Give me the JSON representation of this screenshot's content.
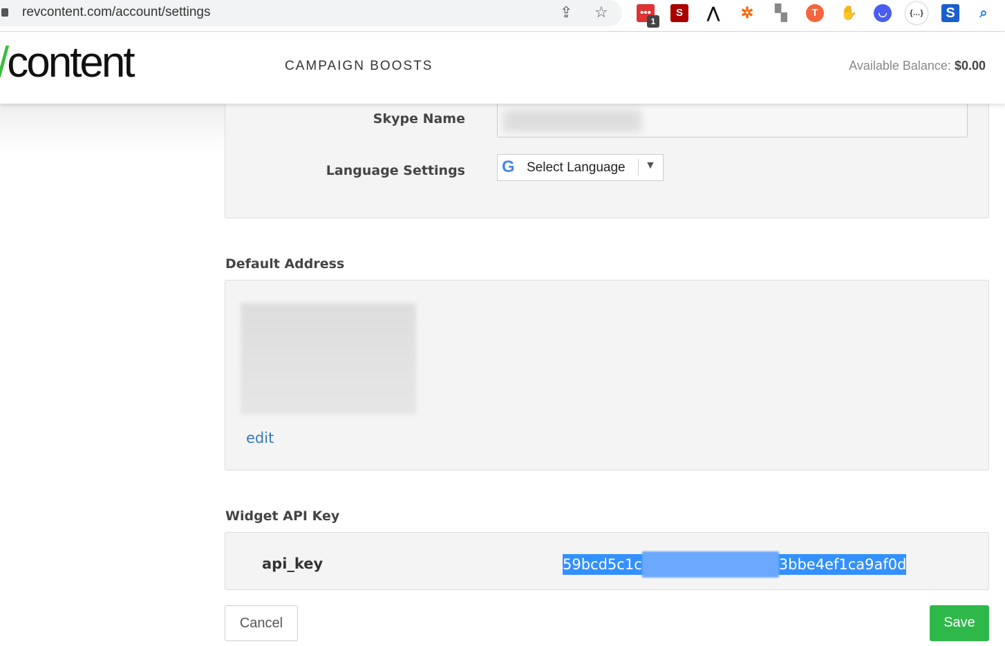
{
  "browser": {
    "url": "revcontent.com/account/settings",
    "extension_badge": "1"
  },
  "header": {
    "logo": "revcontent",
    "nav": "CAMPAIGN BOOSTS",
    "balance_label": "Available Balance:",
    "balance_value": "$0.00"
  },
  "profile": {
    "skype_label": "Skype Name",
    "language_label": "Language Settings",
    "language_select": "Select Language"
  },
  "address": {
    "title": "Default Address",
    "edit": "edit"
  },
  "api": {
    "title": "Widget API Key",
    "label": "api_key",
    "key_start": "59bcd5c1c",
    "key_end": "3bbe4ef1ca9af0d"
  },
  "actions": {
    "cancel": "Cancel",
    "save": "Save"
  },
  "colors": {
    "accent_green": "#3dbd3d",
    "save": "#2fb84a",
    "link": "#337ab7",
    "selection": "#3390ff"
  }
}
